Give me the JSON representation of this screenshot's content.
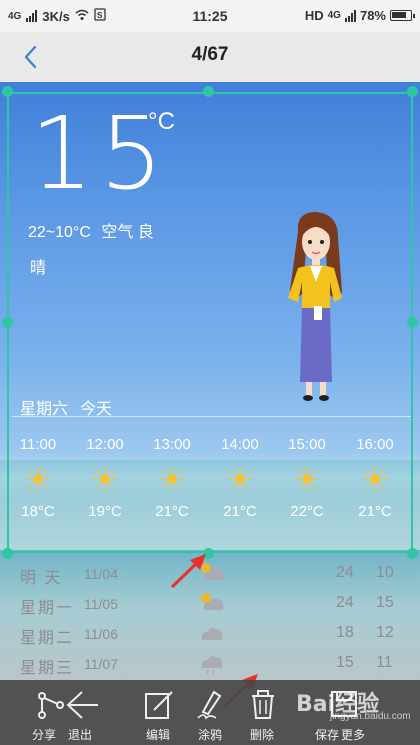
{
  "status_bar": {
    "network": "4G",
    "speed": "3K/s",
    "time": "11:25",
    "hd": "HD",
    "network_right": "4G",
    "battery": "78%",
    "icons": [
      "signal-icon",
      "wifi-icon",
      "sim-icon",
      "battery-icon"
    ]
  },
  "header": {
    "counter": "4/67",
    "back_icon": "chevron-left-icon"
  },
  "photo": {
    "temperature": "15",
    "unit": "°C",
    "range": "22~10°C",
    "air": "空气 良",
    "condition": "晴",
    "day": "星期六",
    "today": "今天",
    "hourly": [
      {
        "time": "11:00",
        "temp": "18°C",
        "icon": "sun-icon"
      },
      {
        "time": "12:00",
        "temp": "19°C",
        "icon": "sun-icon"
      },
      {
        "time": "13:00",
        "temp": "21°C",
        "icon": "sun-icon"
      },
      {
        "time": "14:00",
        "temp": "21°C",
        "icon": "sun-icon"
      },
      {
        "time": "15:00",
        "temp": "22°C",
        "icon": "sun-icon"
      },
      {
        "time": "16:00",
        "temp": "21°C",
        "icon": "sun-icon"
      }
    ],
    "forecast": [
      {
        "day": "明 天",
        "date": "11/04",
        "hi": "24",
        "lo": "10",
        "icon": "partly-cloudy-icon"
      },
      {
        "day": "星期一",
        "date": "11/05",
        "hi": "24",
        "lo": "15",
        "icon": "partly-cloudy-icon"
      },
      {
        "day": "星期二",
        "date": "11/06",
        "hi": "18",
        "lo": "12",
        "icon": "cloud-icon"
      },
      {
        "day": "星期三",
        "date": "11/07",
        "hi": "15",
        "lo": "11",
        "icon": "rain-cloud-icon"
      }
    ]
  },
  "toolbar": {
    "share": "分享",
    "exit": "退出",
    "edit": "编辑",
    "doodle": "涂鸦",
    "delete": "删除",
    "save": "保存",
    "more": "更多"
  },
  "watermark": {
    "brand": "Bai经验",
    "url": "jingyan.baidu.com"
  },
  "colors": {
    "accent": "#2fc6a6",
    "arrow": "#e8302a",
    "sun": "#f6c230"
  }
}
